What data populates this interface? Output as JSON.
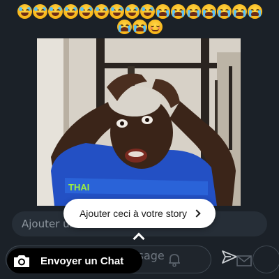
{
  "reaction_emojis": {
    "row1": [
      "laugh-cry",
      "laugh-cry",
      "laugh-cry",
      "laugh-cry",
      "laugh-cry",
      "laugh-cry",
      "laugh-cry",
      "laugh-cry",
      "laugh-cry",
      "loud-cry",
      "loud-cry",
      "loud-cry",
      "loud-cry",
      "loud-cry",
      "loud-cry",
      "loud-cry"
    ],
    "row2": [
      "loud-cry",
      "loud-cry",
      "relieved"
    ]
  },
  "story_photo": {
    "shirt_text": "THAI"
  },
  "comment_bar": {
    "placeholder": "Ajouter un"
  },
  "add_to_story": {
    "label": "Ajouter ceci à votre story"
  },
  "message_bar": {
    "placeholder": "Envoyer un message",
    "chat_button_label": "Envoyer un Chat"
  },
  "colors": {
    "background": "#1b2128",
    "pill": "#ffffff",
    "chat_button": "#000000"
  }
}
